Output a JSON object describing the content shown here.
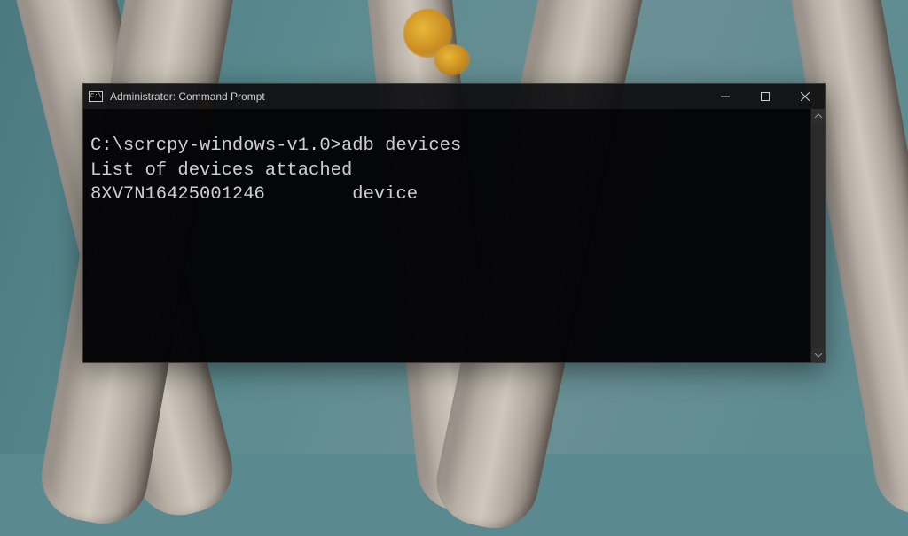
{
  "window": {
    "title": "Administrator: Command Prompt",
    "icon_label": "C:\\"
  },
  "terminal": {
    "prompt_path": "C:\\scrcpy-windows-v1.0>",
    "command": "adb devices",
    "output_header": "List of devices attached",
    "device_id": "8XV7N16425001246",
    "device_gap": "        ",
    "device_status": "device"
  }
}
